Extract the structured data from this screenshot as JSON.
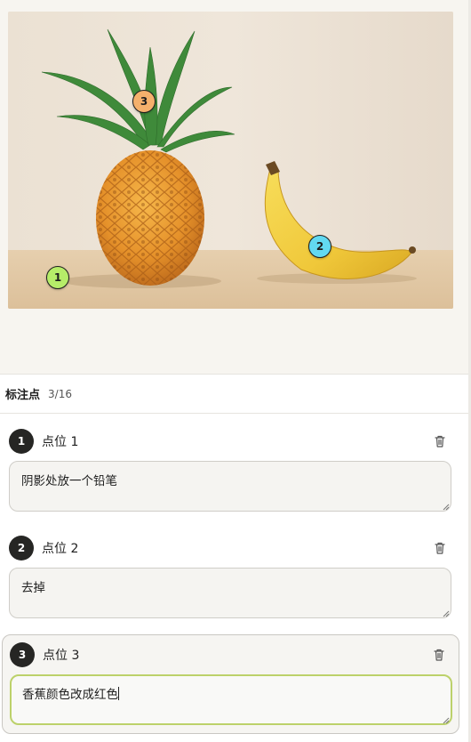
{
  "image": {
    "alt_subjects": [
      "pineapple-icon",
      "banana-icon"
    ],
    "markers": [
      {
        "number": "1",
        "color": "#b6ed69"
      },
      {
        "number": "2",
        "color": "#62d9f1"
      },
      {
        "number": "3",
        "color": "#f5b06c"
      }
    ]
  },
  "panel": {
    "title": "标注点",
    "count": "3/16"
  },
  "points": [
    {
      "number": "1",
      "label": "点位 1",
      "note": "阴影处放一个铅笔",
      "active": false
    },
    {
      "number": "2",
      "label": "点位 2",
      "note": "去掉",
      "active": false
    },
    {
      "number": "3",
      "label": "点位 3",
      "note": "香蕉颜色改成红色",
      "active": true
    }
  ],
  "colors": {
    "focus_ring": "#bcd16a",
    "badge_bg": "#262624",
    "page_bg": "#f7f5f0"
  }
}
